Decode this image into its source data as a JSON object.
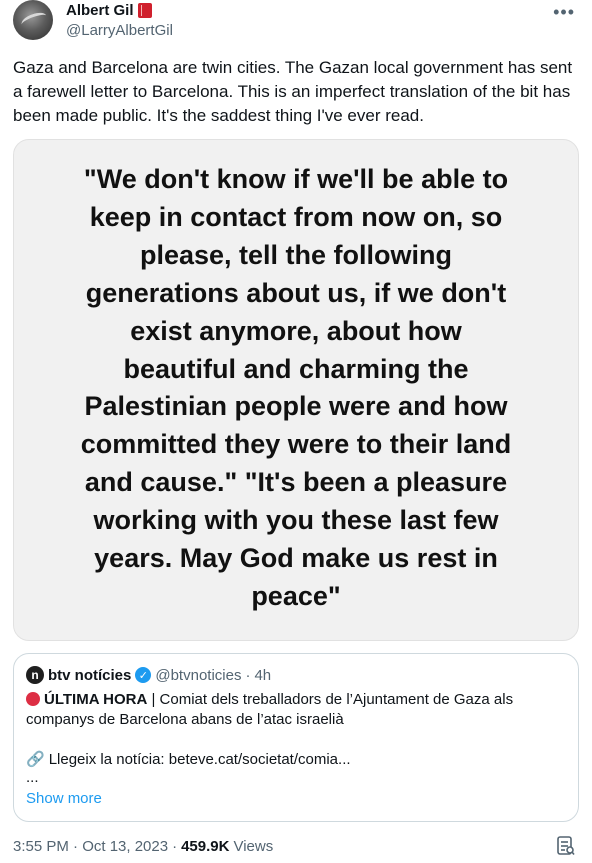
{
  "author": {
    "display_name": "Albert Gil",
    "handle": "@LarryAlbertGil"
  },
  "tweet": {
    "text": "Gaza and Barcelona are twin cities. The Gazan local government has sent a farewell letter to Barcelona. This is an imperfect translation of the bit has been made public. It's the saddest thing I've ever read."
  },
  "image": {
    "quote_text": "\"We don't know if we'll be able to keep in contact from now on, so please, tell the following generations about us, if we don't exist anymore, about how beautiful and charming the Palestinian people were and how committed they were to their land and cause.\" \"It's been a pleasure working with you these last few years. May God make us rest in peace\""
  },
  "quoted_tweet": {
    "logo_letter": "n",
    "name": "btv notícies",
    "handle": "@btvnoticies",
    "separator": "·",
    "time": "4h",
    "breaking_label": "ÚLTIMA HORA",
    "body": " | Comiat dels treballadors de l’Ajuntament de Gaza als companys de Barcelona abans de l’atac israelià",
    "link_prefix": "Llegeix la notícia: ",
    "link_text": "beteve.cat/societat/comia...",
    "ellipsis": "...",
    "show_more": "Show more"
  },
  "meta": {
    "time": "3:55 PM · Oct 13, 2023",
    "separator": "·",
    "views_count": "459.9K",
    "views_label": "Views"
  },
  "icons": {
    "more": "more-icon",
    "verified": "verified-badge-icon",
    "book": "red-book-icon",
    "link": "link-icon",
    "analytics": "analytics-icon"
  },
  "colors": {
    "accent": "#1d9bf0",
    "text": "#0f1419",
    "secondary": "#536471",
    "breaking_dot": "#dd2e44"
  }
}
